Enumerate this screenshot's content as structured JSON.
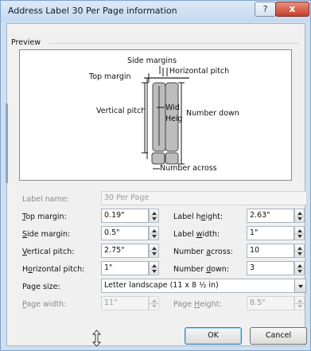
{
  "window": {
    "title": "Address Label 30 Per Page information",
    "help_label": "?",
    "close_label": "x"
  },
  "preview": {
    "group_label": "Preview",
    "labels": {
      "side_margins": "Side margins",
      "top_margin": "Top margin",
      "horizontal_pitch": "Horizontal pitch",
      "vertical_pitch": "Vertical pitch",
      "width": "Wid",
      "height": "Heig",
      "number_down": "Number down",
      "number_across": "Number across"
    }
  },
  "form": {
    "label_name": {
      "label": "Label name:",
      "value": "30 Per Page"
    },
    "top_margin": {
      "label_pre": "",
      "label_key": "T",
      "label_post": "op margin:",
      "value": "0.19\""
    },
    "side_margin": {
      "label_pre": "",
      "label_key": "S",
      "label_post": "ide margin:",
      "value": "0.5\""
    },
    "vertical_pitch": {
      "label_pre": "",
      "label_key": "V",
      "label_post": "ertical pitch:",
      "value": "2.75\""
    },
    "horizontal_pitch": {
      "label_pre": "H",
      "label_key": "o",
      "label_post": "rizontal pitch:",
      "value": "1\""
    },
    "label_height": {
      "label_pre": "Label h",
      "label_key": "e",
      "label_post": "ight:",
      "value": "2.63\""
    },
    "label_width": {
      "label_pre": "Label ",
      "label_key": "w",
      "label_post": "idth:",
      "value": "1\""
    },
    "number_across": {
      "label_pre": "Number ",
      "label_key": "a",
      "label_post": "cross:",
      "value": "10"
    },
    "number_down": {
      "label_pre": "Number ",
      "label_key": "d",
      "label_post": "own:",
      "value": "3"
    },
    "page_size": {
      "label": "Page size:",
      "value": "Letter landscape (11 x 8 ½ in)"
    },
    "page_width": {
      "label_pre": "",
      "label_key": "P",
      "label_post": "age width:",
      "value": "11\""
    },
    "page_height": {
      "label_pre": "Page ",
      "label_key": "H",
      "label_post": "eight:",
      "value": "8.5\""
    }
  },
  "buttons": {
    "ok": "OK",
    "cancel": "Cancel"
  },
  "icons": {
    "resize": "resize-vertical-icon",
    "help": "help-icon",
    "close": "close-icon",
    "spin_up": "spin-up-icon",
    "spin_down": "spin-down-icon",
    "dropdown": "chevron-down-icon"
  }
}
